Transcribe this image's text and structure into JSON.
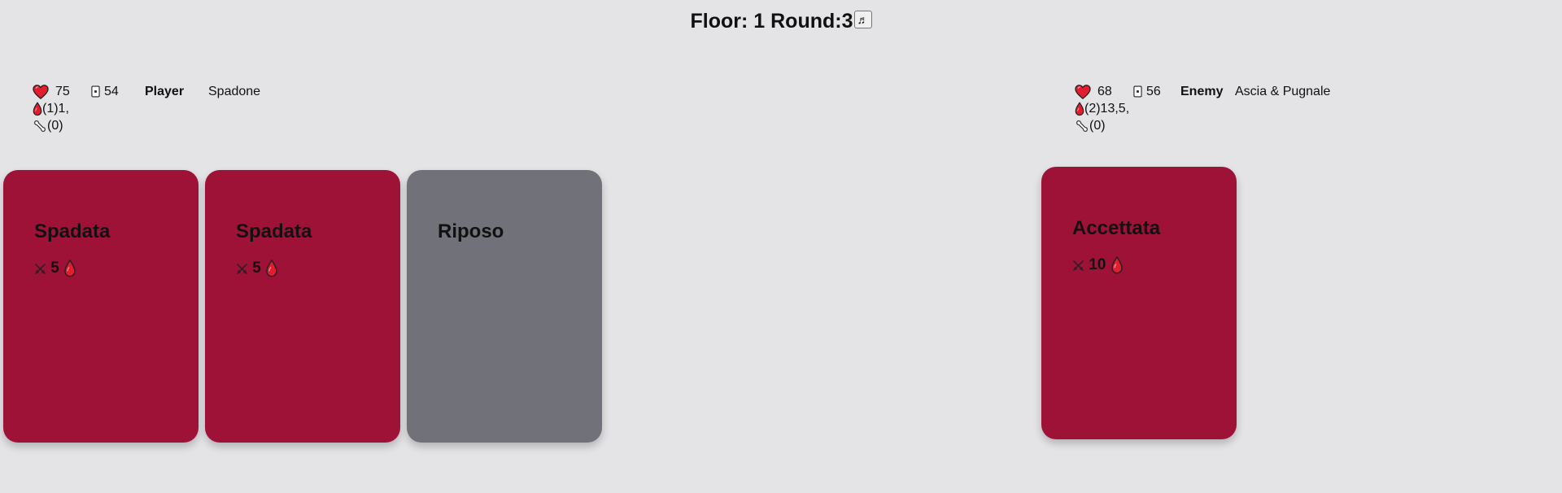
{
  "header": {
    "floor_label": "Floor:",
    "floor": "1",
    "round_label": "Round:",
    "round": "3",
    "music_button": "♬"
  },
  "player": {
    "hp": "75",
    "deck": "54",
    "name": "Player",
    "weapon": "Spadone",
    "bleed": "(1)1,",
    "bone": "(0)"
  },
  "enemy": {
    "hp": "68",
    "deck": "56",
    "name": "Enemy",
    "weapon": "Ascia & Pugnale",
    "bleed": "(2)13,5,",
    "bone": "(0)"
  },
  "player_cards": [
    {
      "title": "Spadata",
      "damage": "5",
      "type": "attack",
      "effect": "bleed"
    },
    {
      "title": "Spadata",
      "damage": "5",
      "type": "attack",
      "effect": "bleed"
    },
    {
      "title": "Riposo",
      "type": "rest"
    }
  ],
  "enemy_cards": [
    {
      "title": "Accettata",
      "damage": "10",
      "type": "attack",
      "effect": "bleed"
    }
  ],
  "icons": {
    "hp": "heart-icon",
    "deck": "card-deck-icon",
    "bleed": "blood-drop-icon",
    "bone": "bone-icon",
    "attack": "crossed-swords-icon"
  },
  "colors": {
    "background": "#e4e4e7",
    "attack_card": "#9e1238",
    "rest_card": "#71717a",
    "heart": "#e11d2e"
  }
}
